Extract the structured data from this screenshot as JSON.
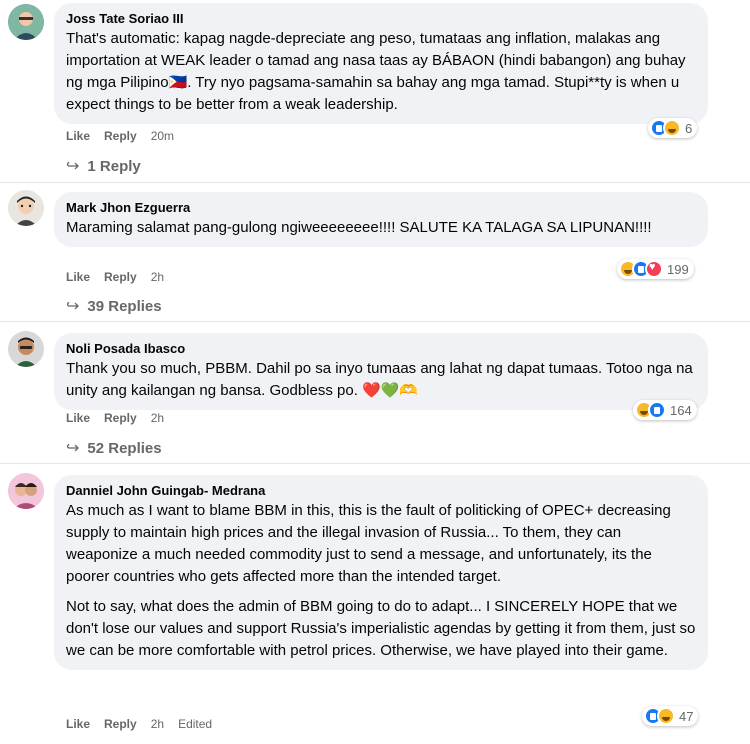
{
  "comments": [
    {
      "author": "Joss Tate Soriao III",
      "paragraphs": [
        "That's automatic: kapag nagde-depreciate ang peso, tumataas ang inflation, malakas ang importation at WEAK leader o tamad ang nasa taas ay BÁBAON (hindi babangon) ang buhay ng mga Pilipino🇵🇭. Try nyo pagsama-samahin sa bahay ang mga tamad. Stupi**ty is when u expect things to be better from a weak leadership."
      ],
      "like_label": "Like",
      "reply_label": "Reply",
      "time": "20m",
      "reaction_count": "6",
      "reaction_icons": [
        "like-icon",
        "haha-icon"
      ],
      "replies_label": "1 Reply"
    },
    {
      "author": "Mark Jhon Ezguerra",
      "paragraphs": [
        "Maraming salamat pang-gulong ngiweeeeeeee!!!! SALUTE KA TALAGA SA LIPUNAN!!!!"
      ],
      "like_label": "Like",
      "reply_label": "Reply",
      "time": "2h",
      "reaction_count": "199",
      "reaction_icons": [
        "haha-icon",
        "like-icon",
        "love-icon"
      ],
      "replies_label": "39 Replies"
    },
    {
      "author": "Noli Posada Ibasco",
      "paragraphs": [
        "Thank you so much, PBBM. Dahil po sa inyo tumaas ang lahat ng dapat tumaas. Totoo nga na unity ang kailangan ng bansa. Godbless po. ❤️💚🫶"
      ],
      "like_label": "Like",
      "reply_label": "Reply",
      "time": "2h",
      "reaction_count": "164",
      "reaction_icons": [
        "haha-icon",
        "like-icon"
      ],
      "replies_label": "52 Replies"
    },
    {
      "author": "Danniel John Guingab- Medrana",
      "paragraphs": [
        "As much as I want to blame BBM in this, this is the fault of politicking of OPEC+ decreasing supply to maintain high prices and the illegal invasion of Russia... To them, they can weaponize a much needed commodity just to send a message, and unfortunately, its the poorer countries who gets affected more than the intended target.",
        "Not to say, what does the admin of BBM going to do to adapt... I SINCERELY HOPE that we don't lose our values and support Russia's imperialistic agendas by getting it from them, just so we can be more comfortable with petrol prices. Otherwise, we have played into their game."
      ],
      "like_label": "Like",
      "reply_label": "Reply",
      "time": "2h",
      "edited_label": "Edited",
      "reaction_count": "47",
      "reaction_icons": [
        "like-icon",
        "haha-icon"
      ]
    }
  ],
  "replies_arrow": "↪"
}
